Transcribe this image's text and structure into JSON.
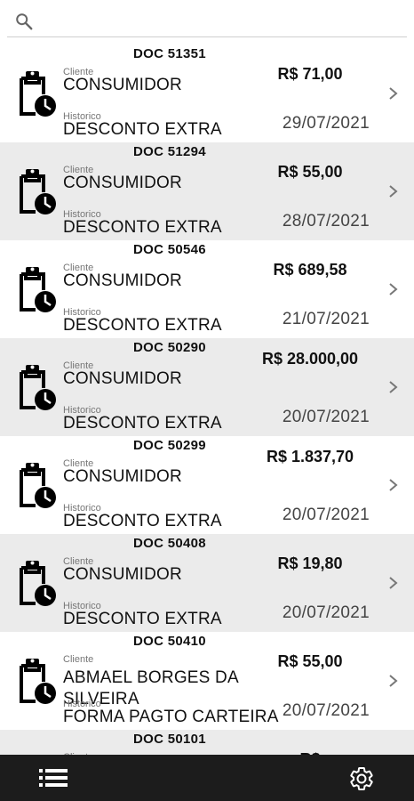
{
  "search": {
    "placeholder": ""
  },
  "labels": {
    "cliente": "Cliente",
    "historico": "Historico"
  },
  "items": [
    {
      "doc": "DOC 51351",
      "cliente": "CONSUMIDOR",
      "historico": "DESCONTO EXTRA",
      "valor": "R$ 71,00",
      "data": "29/07/2021"
    },
    {
      "doc": "DOC 51294",
      "cliente": "CONSUMIDOR",
      "historico": "DESCONTO EXTRA",
      "valor": "R$ 55,00",
      "data": "28/07/2021"
    },
    {
      "doc": "DOC 50546",
      "cliente": "CONSUMIDOR",
      "historico": "DESCONTO EXTRA",
      "valor": "R$ 689,58",
      "data": "21/07/2021"
    },
    {
      "doc": "DOC 50290",
      "cliente": "CONSUMIDOR",
      "historico": "DESCONTO EXTRA",
      "valor": "R$ 28.000,00",
      "data": "20/07/2021"
    },
    {
      "doc": "DOC 50299",
      "cliente": "CONSUMIDOR",
      "historico": "DESCONTO EXTRA",
      "valor": "R$ 1.837,70",
      "data": "20/07/2021"
    },
    {
      "doc": "DOC 50408",
      "cliente": "CONSUMIDOR",
      "historico": "DESCONTO EXTRA",
      "valor": "R$ 19,80",
      "data": "20/07/2021"
    },
    {
      "doc": "DOC 50410",
      "cliente": "ABMAEL BORGES DA SILVEIRA",
      "historico": "FORMA PAGTO CARTEIRA",
      "valor": "R$ 55,00",
      "data": "20/07/2021"
    },
    {
      "doc": "DOC 50101",
      "cliente": "",
      "historico": "",
      "valor": "R$",
      "data": ""
    }
  ],
  "icons": {
    "search": "search-icon",
    "row": "clipboard-clock-icon",
    "chevron": "chevron-right-icon",
    "menu": "list-menu-icon",
    "settings": "gear-icon"
  }
}
